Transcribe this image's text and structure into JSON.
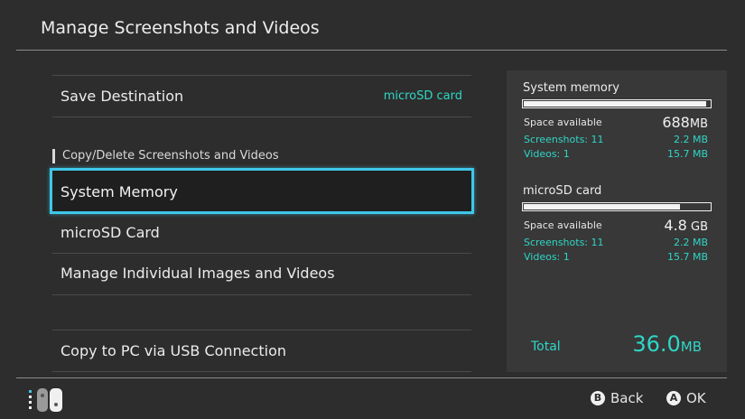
{
  "header": {
    "title": "Manage Screenshots and Videos"
  },
  "menu": {
    "save_destination": {
      "label": "Save Destination",
      "value": "microSD card"
    },
    "section_label": "Copy/Delete Screenshots and Videos",
    "items": [
      {
        "label": "System Memory",
        "selected": true
      },
      {
        "label": "microSD Card"
      },
      {
        "label": "Manage Individual Images and Videos"
      }
    ],
    "copy_usb": {
      "label": "Copy to PC via USB Connection"
    }
  },
  "storage": {
    "system": {
      "title": "System memory",
      "space_label": "Space available",
      "space_value": "688",
      "space_unit": "MB",
      "usage_fraction": 0.98,
      "screenshots_label": "Screenshots: 11",
      "screenshots_size": "2.2 MB",
      "videos_label": "Videos: 1",
      "videos_size": "15.7 MB"
    },
    "sd": {
      "title": "microSD card",
      "space_label": "Space available",
      "space_value": "4.8",
      "space_unit": "GB",
      "usage_fraction": 0.84,
      "screenshots_label": "Screenshots: 11",
      "screenshots_size": "2.2 MB",
      "videos_label": "Videos: 1",
      "videos_size": "15.7 MB"
    },
    "total_label": "Total",
    "total_value": "36.0",
    "total_unit": "MB"
  },
  "footer": {
    "back_button_glyph": "B",
    "back_label": "Back",
    "ok_button_glyph": "A",
    "ok_label": "OK",
    "controller_icon": "joy-con-icon",
    "colors": {
      "accent": "#3ec7e8",
      "highlight": "#2fd6c6"
    }
  }
}
